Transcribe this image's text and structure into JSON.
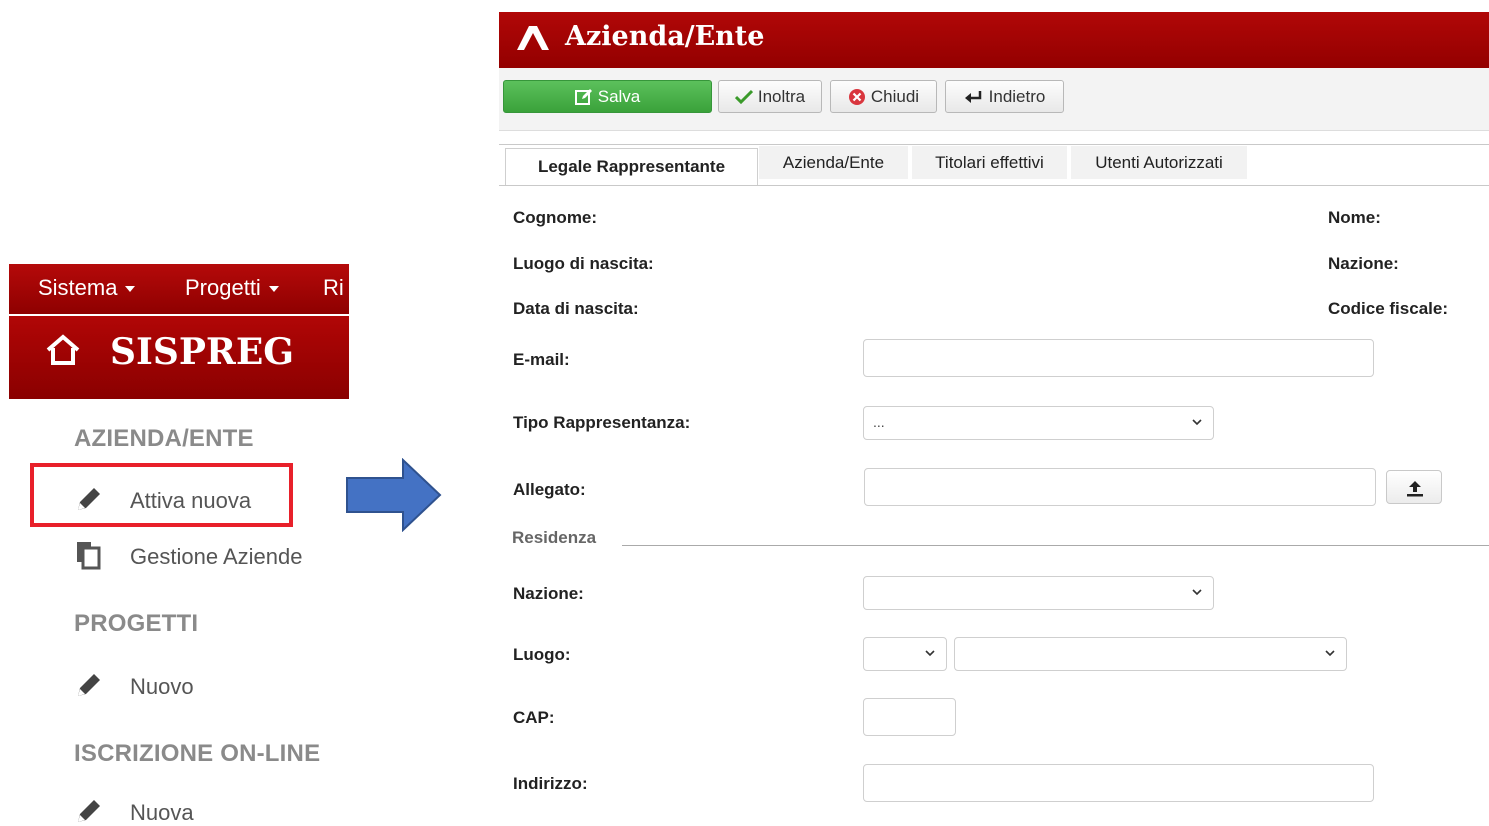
{
  "left_panel": {
    "top_menu": [
      "Sistema",
      "Progetti",
      "Ri"
    ],
    "brand": "SISPREG",
    "sections": [
      {
        "title": "AZIENDA/ENTE",
        "items": [
          "Attiva nuova",
          "Gestione Aziende"
        ]
      },
      {
        "title": "PROGETTI",
        "items": [
          "Nuovo"
        ]
      },
      {
        "title": "ISCRIZIONE ON-LINE",
        "items": [
          "Nuova"
        ]
      }
    ],
    "icons": {
      "home": "home-icon",
      "pencil": "pencil-icon",
      "copy": "copy-icon"
    }
  },
  "right_panel": {
    "title": "Azienda/Ente",
    "toolbar": {
      "save": "Salva",
      "forward": "Inoltra",
      "close": "Chiudi",
      "back": "Indietro"
    },
    "tabs": [
      "Legale Rappresentante",
      "Azienda/Ente",
      "Titolari effettivi",
      "Utenti Autorizzati"
    ],
    "active_tab": "Legale Rappresentante",
    "fields": {
      "cognome": "Cognome:",
      "nome": "Nome:",
      "luogo_nascita": "Luogo di nascita:",
      "nazione_top": "Nazione:",
      "data_nascita": "Data di nascita:",
      "codice_fiscale": "Codice fiscale:",
      "email": "E-mail:",
      "tipo_rappresentanza": "Tipo Rappresentanza:",
      "tipo_rappresentanza_value": "...",
      "allegato": "Allegato:",
      "residenza": "Residenza",
      "nazione": "Nazione:",
      "luogo": "Luogo:",
      "cap": "CAP:",
      "indirizzo": "Indirizzo:"
    }
  },
  "colors": {
    "header_red": "#a30000",
    "save_green": "#3aa23a",
    "highlight_red": "#e8202a",
    "arrow_blue": "#4472c4"
  }
}
